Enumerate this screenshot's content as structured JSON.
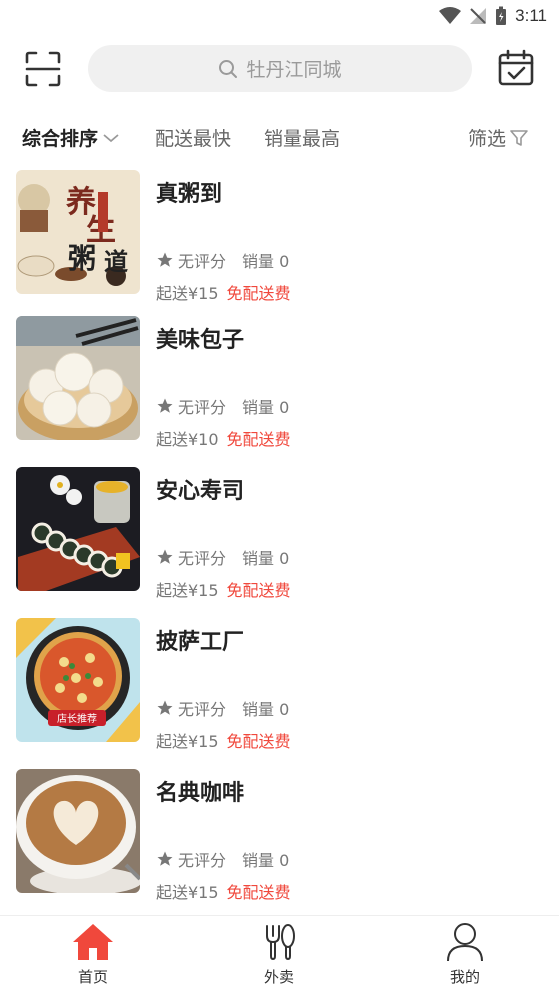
{
  "status_bar": {
    "time": "3:11"
  },
  "header": {
    "search_placeholder": "牡丹江同城"
  },
  "sort": {
    "items": [
      "综合排序",
      "配送最快",
      "销量最高",
      "筛选"
    ]
  },
  "shops": [
    {
      "name": "真粥到",
      "rating": "无评分",
      "sales": "销量 0",
      "min_order": "起送¥15",
      "delivery": "免配送费"
    },
    {
      "name": "美味包子",
      "rating": "无评分",
      "sales": "销量 0",
      "min_order": "起送¥10",
      "delivery": "免配送费"
    },
    {
      "name": "安心寿司",
      "rating": "无评分",
      "sales": "销量 0",
      "min_order": "起送¥15",
      "delivery": "免配送费"
    },
    {
      "name": "披萨工厂",
      "rating": "无评分",
      "sales": "销量 0",
      "min_order": "起送¥15",
      "delivery": "免配送费"
    },
    {
      "name": "名典咖啡",
      "rating": "无评分",
      "sales": "销量 0",
      "min_order": "起送¥15",
      "delivery": "免配送费"
    }
  ],
  "pizza_badge": "店长推荐",
  "tabs": [
    {
      "label": "首页",
      "active": true
    },
    {
      "label": "外卖",
      "active": false
    },
    {
      "label": "我的",
      "active": false
    }
  ],
  "colors": {
    "accent": "#f0483c",
    "text_primary": "#222222",
    "text_secondary": "#777777"
  }
}
